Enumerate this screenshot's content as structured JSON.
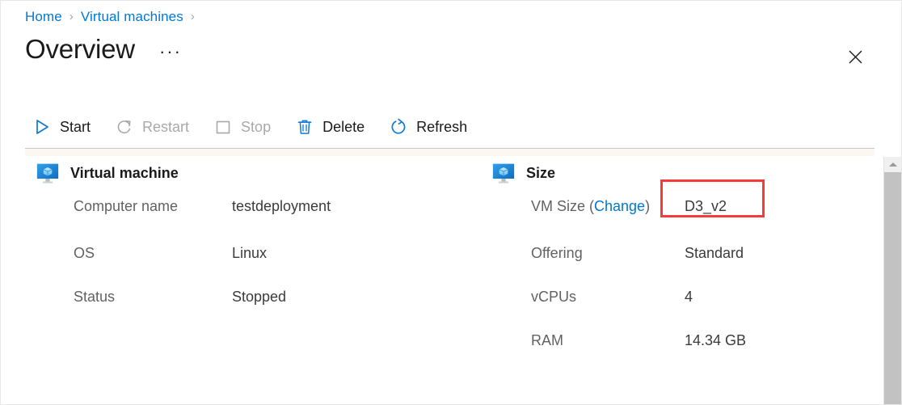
{
  "breadcrumb": {
    "items": [
      {
        "label": "Home"
      },
      {
        "label": "Virtual machines"
      }
    ],
    "separator": "›"
  },
  "header": {
    "title": "Overview",
    "ellipsis": "···",
    "close_label": "Close"
  },
  "toolbar": {
    "items": [
      {
        "label": "Start",
        "icon": "play-icon",
        "enabled": true
      },
      {
        "label": "Restart",
        "icon": "restart-icon",
        "enabled": false
      },
      {
        "label": "Stop",
        "icon": "stop-icon",
        "enabled": false
      },
      {
        "label": "Delete",
        "icon": "trash-icon",
        "enabled": true
      },
      {
        "label": "Refresh",
        "icon": "refresh-icon",
        "enabled": true
      }
    ]
  },
  "sections": {
    "virtual_machine": {
      "title": "Virtual machine",
      "icon": "virtual-machine-icon",
      "rows": [
        {
          "key": "Computer name",
          "value": "testdeployment"
        },
        {
          "key": "OS",
          "value": "Linux"
        },
        {
          "key": "Status",
          "value": "Stopped"
        }
      ]
    },
    "size": {
      "title": "Size",
      "icon": "virtual-machine-icon",
      "rows": [
        {
          "key_prefix": "VM Size (",
          "key_link": "Change",
          "key_suffix": ")",
          "value": "D3_v2",
          "highlighted": true
        },
        {
          "key": "Offering",
          "value": "Standard"
        },
        {
          "key": "vCPUs",
          "value": "4"
        },
        {
          "key": "RAM",
          "value": "14.34 GB"
        }
      ]
    }
  },
  "colors": {
    "link": "#0078d4",
    "highlight_box": "#f93a3a",
    "label_text": "#626262",
    "value_text": "#3b3b3b",
    "disabled_text": "#a9a9a9",
    "accent_band": "#fdf7f1"
  },
  "scrollbar": {
    "up_arrow_label": "Scroll up"
  }
}
